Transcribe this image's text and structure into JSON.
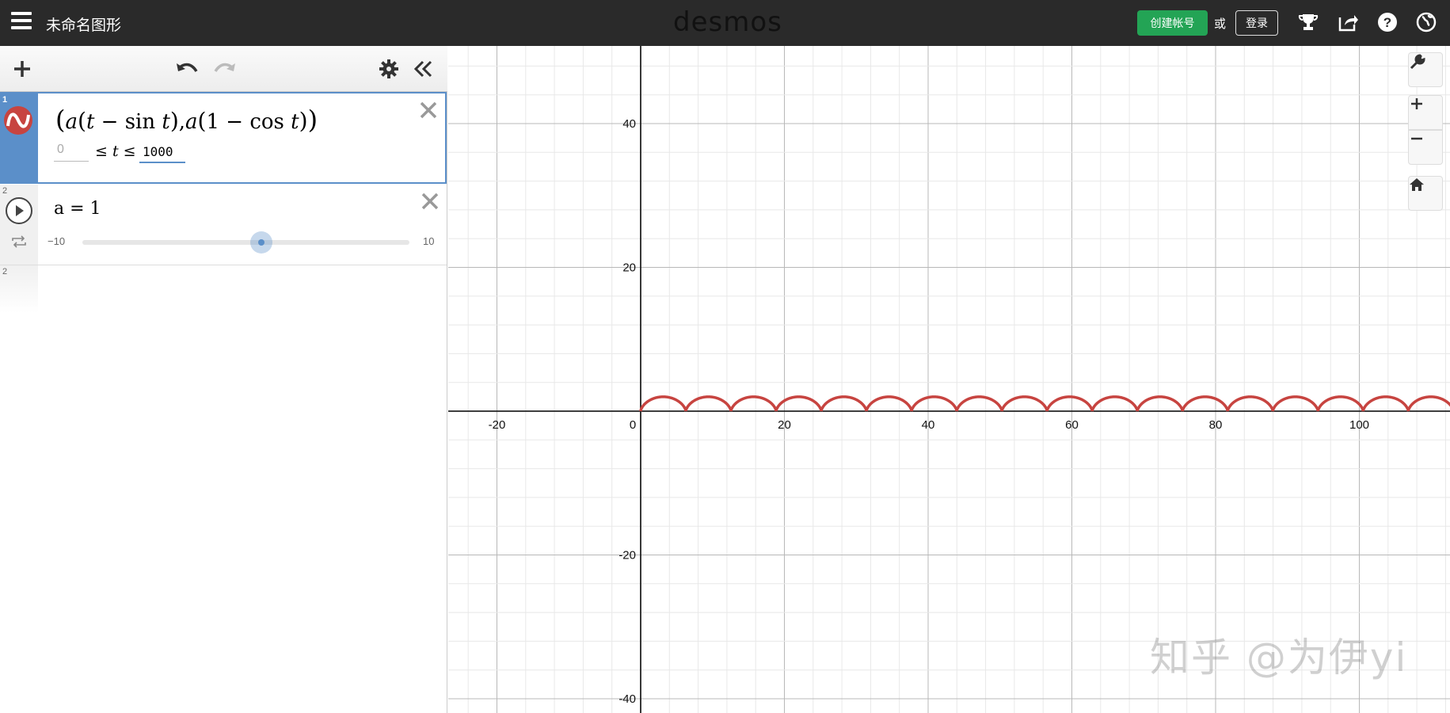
{
  "header": {
    "title": "未命名图形",
    "logo": "desmos",
    "create_account_label": "创建帐号",
    "or_text": "或",
    "login_label": "登录",
    "bg_color": "#2a2a2a",
    "accent_color": "#23a455"
  },
  "toolbar": {
    "icons": [
      "add-icon",
      "undo-icon",
      "redo-icon",
      "settings-gear-icon",
      "collapse-panel-icon"
    ]
  },
  "expressions": [
    {
      "number": "1",
      "type": "parametric",
      "formula": "(a(t − sin t), a(1 − cos t))",
      "range_min_placeholder": "0",
      "range_var": "t",
      "range_max": "1000",
      "color": "#c74440"
    },
    {
      "number": "2",
      "type": "slider",
      "formula": "a = 1",
      "slider_min": "−10",
      "slider_max": "10",
      "value": 1
    },
    {
      "number": "2",
      "type": "empty"
    }
  ],
  "graph": {
    "x_ticks": [
      "-20",
      "0",
      "20",
      "40",
      "60",
      "80",
      "100"
    ],
    "y_ticks": [
      "40",
      "20",
      "-20",
      "-40"
    ],
    "curve": "cycloid",
    "curve_color": "#c74440",
    "controls": [
      "wrench-icon",
      "zoom-in-icon",
      "zoom-out-icon",
      "home-icon"
    ]
  },
  "watermark": "知乎 @为伊yi"
}
